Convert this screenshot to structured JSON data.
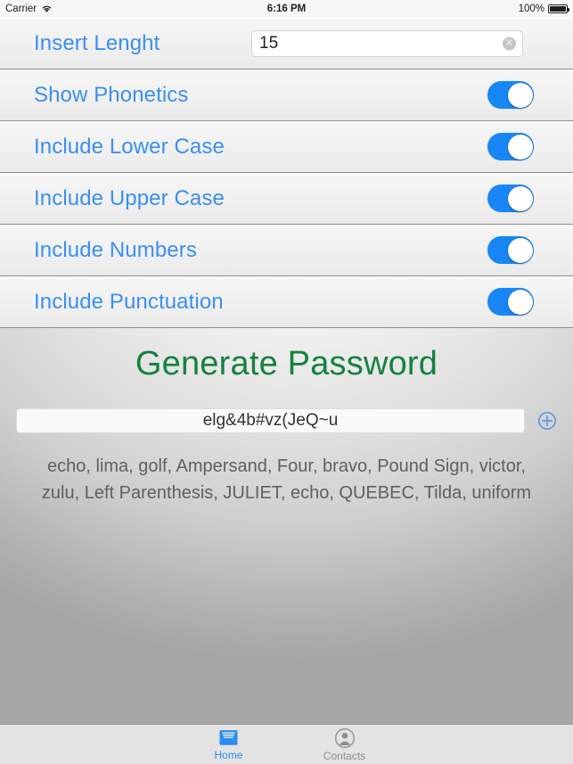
{
  "status_bar": {
    "carrier": "Carrier",
    "wifi_icon": "wifi-icon",
    "time": "6:16 PM",
    "battery_percent": "100%",
    "battery_icon": "battery-icon"
  },
  "settings": {
    "rows": [
      {
        "label": "Insert Lenght",
        "control": "textfield",
        "value": "15",
        "clear_icon": "✕"
      },
      {
        "label": "Show Phonetics",
        "control": "switch",
        "value": "on"
      },
      {
        "label": "Include Lower Case",
        "control": "switch",
        "value": "on"
      },
      {
        "label": "Include Upper Case",
        "control": "switch",
        "value": "on"
      },
      {
        "label": "Include Numbers",
        "control": "switch",
        "value": "on"
      },
      {
        "label": "Include Punctuation",
        "control": "switch",
        "value": "on"
      }
    ]
  },
  "main": {
    "generate_title": "Generate Password",
    "password": "elg&4b#vz(JeQ~u",
    "add_icon": "plus-circle-icon",
    "phonetics": "echo, lima, golf, Ampersand, Four, bravo, Pound Sign, victor, zulu, Left Parenthesis, JULIET, echo, QUEBEC, Tilda, uniform"
  },
  "tab_bar": {
    "tabs": [
      {
        "label": "Home",
        "icon": "tray-icon",
        "active": true
      },
      {
        "label": "Contacts",
        "icon": "person-circle-icon",
        "active": false
      }
    ]
  },
  "colors": {
    "accent_blue": "#3b8ff0",
    "switch_on": "#1886f5",
    "title_green": "#17813f",
    "tab_active": "#2a8cf0",
    "tab_inactive": "#8e8e8e"
  }
}
